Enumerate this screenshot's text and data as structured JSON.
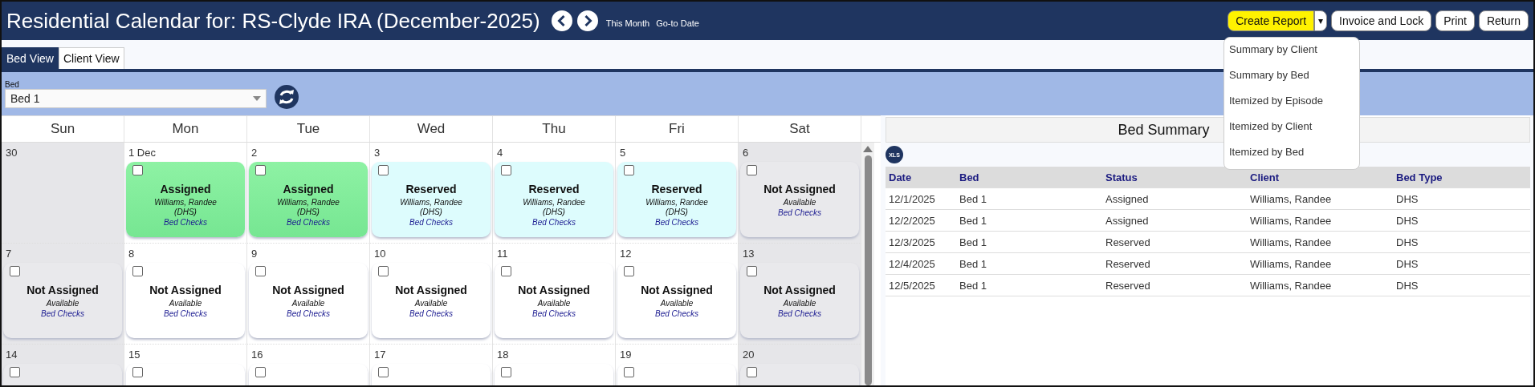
{
  "header": {
    "title": "Residential Calendar for: RS-Clyde IRA (December-2025)",
    "links": [
      "This Month",
      "Go-to Date"
    ],
    "buttons": [
      {
        "label": "Create Report",
        "kind": "split",
        "highlighted": true
      },
      {
        "label": "▾",
        "kind": "caret",
        "highlighted": false
      },
      {
        "label": "Invoice and Lock",
        "kind": "plain",
        "highlighted": false
      },
      {
        "label": "Print",
        "kind": "plain",
        "highlighted": false
      },
      {
        "label": "Return",
        "kind": "plain",
        "highlighted": false
      }
    ],
    "report_menu": [
      "Summary by Client",
      "Summary by Bed",
      "Itemized by Episode",
      "Itemized by Client",
      "Itemized by Bed"
    ]
  },
  "tabs": [
    {
      "label": "Bed View",
      "selected": true
    },
    {
      "label": "Client View",
      "selected": false
    }
  ],
  "bed_filter": {
    "label": "Bed",
    "value": "Bed 1"
  },
  "calendar": {
    "weekdays": [
      "Sun",
      "Mon",
      "Tue",
      "Wed",
      "Thu",
      "Fri",
      "Sat"
    ],
    "weeks": [
      [
        {
          "date": "30",
          "weekend": true
        },
        {
          "date": "1 Dec",
          "weekend": false,
          "card": {
            "kind": "assigned",
            "checked": false,
            "status": "Assigned",
            "detail": "Williams, Randee",
            "bed_type": "(DHS)",
            "link": "Bed Checks"
          }
        },
        {
          "date": "2",
          "weekend": false,
          "card": {
            "kind": "assigned",
            "checked": false,
            "status": "Assigned",
            "detail": "Williams, Randee",
            "bed_type": "(DHS)",
            "link": "Bed Checks"
          }
        },
        {
          "date": "3",
          "weekend": false,
          "card": {
            "kind": "reserved",
            "checked": false,
            "status": "Reserved",
            "detail": "Williams, Randee",
            "bed_type": "(DHS)",
            "link": "Bed Checks"
          }
        },
        {
          "date": "4",
          "weekend": false,
          "card": {
            "kind": "reserved",
            "checked": false,
            "status": "Reserved",
            "detail": "Williams, Randee",
            "bed_type": "(DHS)",
            "link": "Bed Checks"
          }
        },
        {
          "date": "5",
          "weekend": false,
          "card": {
            "kind": "reserved",
            "checked": false,
            "status": "Reserved",
            "detail": "Williams, Randee",
            "bed_type": "(DHS)",
            "link": "Bed Checks"
          }
        },
        {
          "date": "6",
          "weekend": true,
          "card": {
            "kind": "open",
            "checked": false,
            "status": "Not Assigned",
            "detail": "Available",
            "link": "Bed Checks"
          }
        }
      ],
      [
        {
          "date": "7",
          "weekend": true,
          "card": {
            "kind": "open",
            "checked": false,
            "status": "Not Assigned",
            "detail": "Available",
            "link": "Bed Checks"
          }
        },
        {
          "date": "8",
          "weekend": false,
          "card": {
            "kind": "open",
            "checked": false,
            "status": "Not Assigned",
            "detail": "Available",
            "link": "Bed Checks"
          }
        },
        {
          "date": "9",
          "weekend": false,
          "card": {
            "kind": "open",
            "checked": false,
            "status": "Not Assigned",
            "detail": "Available",
            "link": "Bed Checks"
          }
        },
        {
          "date": "10",
          "weekend": false,
          "card": {
            "kind": "open",
            "checked": false,
            "status": "Not Assigned",
            "detail": "Available",
            "link": "Bed Checks"
          }
        },
        {
          "date": "11",
          "weekend": false,
          "card": {
            "kind": "open",
            "checked": false,
            "status": "Not Assigned",
            "detail": "Available",
            "link": "Bed Checks"
          }
        },
        {
          "date": "12",
          "weekend": false,
          "card": {
            "kind": "open",
            "checked": false,
            "status": "Not Assigned",
            "detail": "Available",
            "link": "Bed Checks"
          }
        },
        {
          "date": "13",
          "weekend": true,
          "card": {
            "kind": "open",
            "checked": false,
            "status": "Not Assigned",
            "detail": "Available",
            "link": "Bed Checks"
          }
        }
      ],
      [
        {
          "date": "14",
          "weekend": true,
          "card": {
            "kind": "open",
            "checked": false
          }
        },
        {
          "date": "15",
          "weekend": false,
          "card": {
            "kind": "open",
            "checked": false
          }
        },
        {
          "date": "16",
          "weekend": false,
          "card": {
            "kind": "open",
            "checked": false
          }
        },
        {
          "date": "17",
          "weekend": false,
          "card": {
            "kind": "open",
            "checked": false
          }
        },
        {
          "date": "18",
          "weekend": false,
          "card": {
            "kind": "open",
            "checked": false
          }
        },
        {
          "date": "19",
          "weekend": false,
          "card": {
            "kind": "open",
            "checked": false
          }
        },
        {
          "date": "20",
          "weekend": true,
          "card": {
            "kind": "open",
            "checked": false
          }
        }
      ]
    ]
  },
  "summary": {
    "title": "Bed Summary",
    "export": "XLS",
    "columns": [
      "Date",
      "Bed",
      "Status",
      "Client",
      "Bed Type"
    ],
    "rows": [
      [
        "12/1/2025",
        "Bed 1",
        "Assigned",
        "Williams, Randee",
        "DHS"
      ],
      [
        "12/2/2025",
        "Bed 1",
        "Assigned",
        "Williams, Randee",
        "DHS"
      ],
      [
        "12/3/2025",
        "Bed 1",
        "Reserved",
        "Williams, Randee",
        "DHS"
      ],
      [
        "12/4/2025",
        "Bed 1",
        "Reserved",
        "Williams, Randee",
        "DHS"
      ],
      [
        "12/5/2025",
        "Bed 1",
        "Reserved",
        "Williams, Randee",
        "DHS"
      ]
    ]
  }
}
